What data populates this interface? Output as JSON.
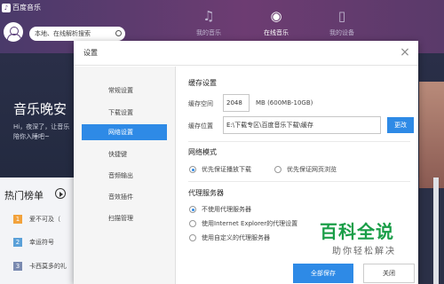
{
  "app": {
    "logo_text": "百度音乐",
    "search_placeholder": "本地、在线解析搜索",
    "nav": [
      {
        "label": "我的音乐",
        "icon": "music-note-icon"
      },
      {
        "label": "在线音乐",
        "icon": "globe-icon"
      },
      {
        "label": "我的设备",
        "icon": "phone-icon"
      }
    ],
    "hero": {
      "title": "音乐晚安",
      "subtitle": "Hi，夜深了，让音乐陪你入睡吧~"
    },
    "hot": {
      "title": "热门榜单",
      "items": [
        {
          "rank": "1",
          "name": "爱不可及（"
        },
        {
          "rank": "2",
          "name": "幸运符号"
        },
        {
          "rank": "3",
          "name": "卡西莫多的礼"
        }
      ]
    }
  },
  "dialog": {
    "title": "设置",
    "close": "×",
    "sidebar": [
      "常规设置",
      "下载设置",
      "网络设置",
      "快捷键",
      "音频输出",
      "音效插件",
      "扫描管理"
    ],
    "active_index": 2,
    "cache": {
      "section": "缓存设置",
      "space_label": "缓存空间",
      "space_value": "2048",
      "space_unit": "MB (600MB-10GB)",
      "location_label": "缓存位置",
      "location_value": "E:\\下载专区\\百度音乐下载\\缓存",
      "change_button": "更改"
    },
    "network_mode": {
      "section": "网络模式",
      "options": [
        "优先保证播放下载",
        "优先保证网页浏览"
      ],
      "selected": 0
    },
    "proxy": {
      "section": "代理服务器",
      "options": [
        "不使用代理服务器",
        "使用Internet Explorer的代理设置",
        "使用自定义的代理服务器"
      ],
      "selected": 0
    },
    "footer": {
      "save_all": "全部保存",
      "close": "关闭"
    }
  },
  "watermark": {
    "logo": "百科全说",
    "sub": "助你轻松解决"
  },
  "colors": {
    "accent": "#2e8ae6",
    "header": "#5b3f7a",
    "watermark": "#1a9e48"
  }
}
